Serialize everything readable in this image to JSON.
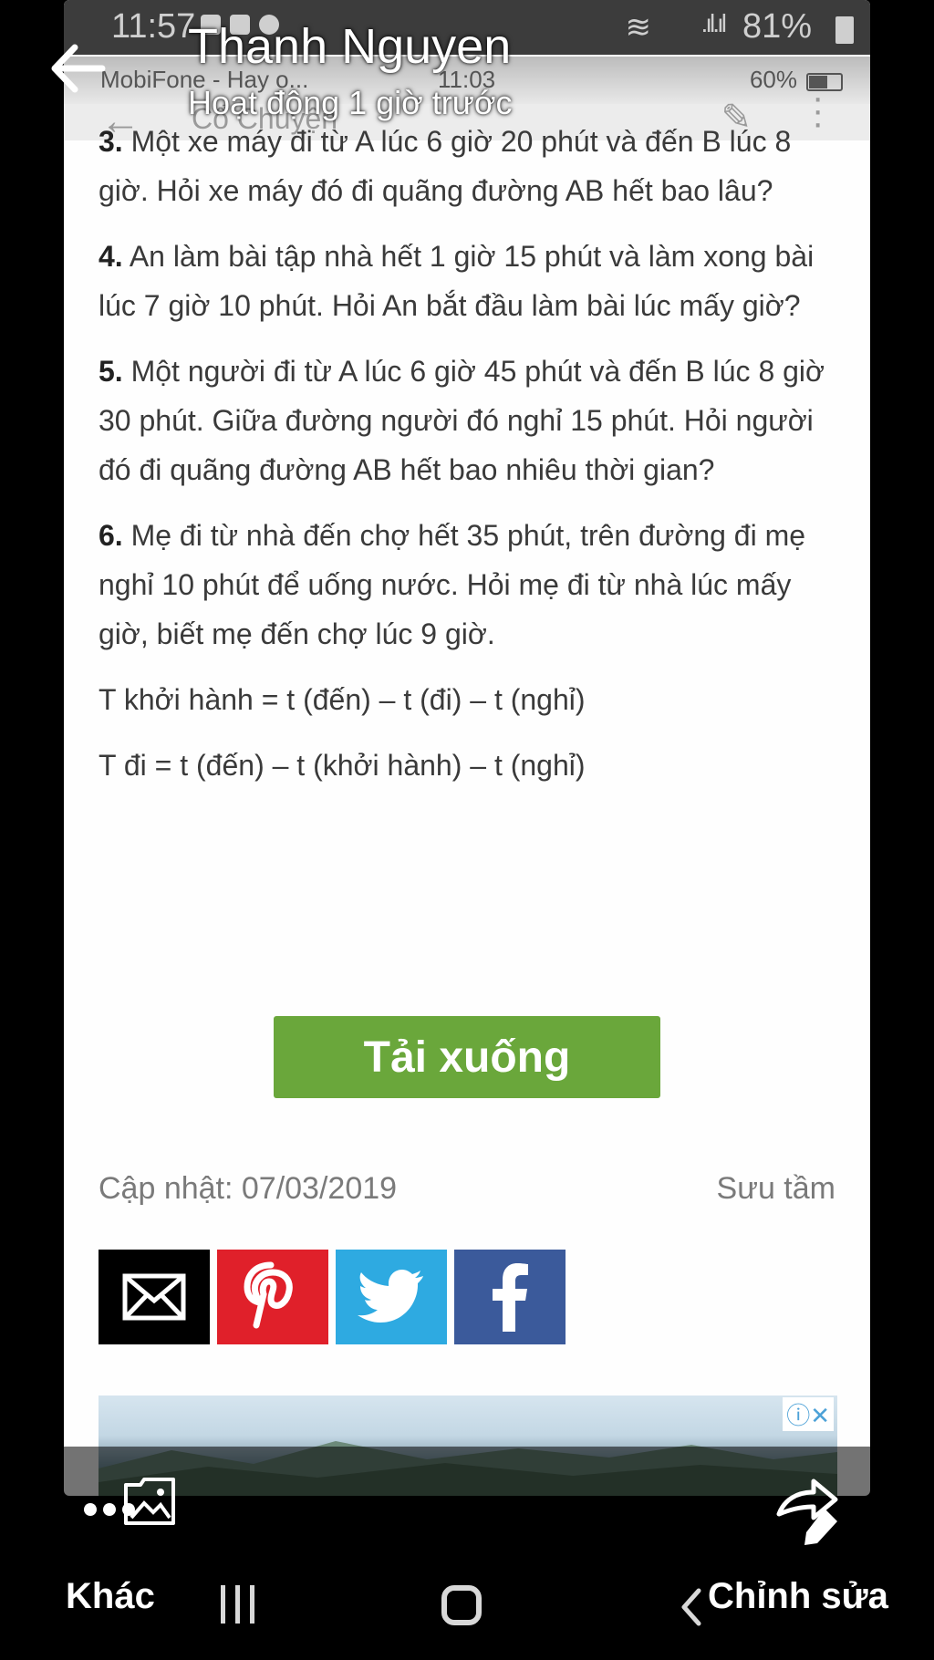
{
  "viewer": {
    "poster_name": "Thanh Nguyen",
    "posted_time": "Hoạt động 1 giờ trước"
  },
  "inner_status": {
    "clock": "11:57",
    "battery": "81%",
    "carrier": "MobiFone - Hay o...",
    "time": "11:03",
    "battery2": "60%"
  },
  "app_bar": {
    "title": "Cổ Chuyện"
  },
  "article": {
    "questions": [
      {
        "num": "3.",
        "text": " Một xe máy đi từ A lúc 6 giờ 20 phút và đến B lúc 8 giờ. Hỏi xe máy đó đi quãng đường AB hết bao lâu?"
      },
      {
        "num": "4.",
        "text": " An làm bài tập nhà hết 1 giờ 15 phút và làm xong bài lúc 7 giờ 10 phút. Hỏi An bắt đầu làm bài lúc mấy giờ?"
      },
      {
        "num": "5.",
        "text": " Một người đi từ A lúc 6 giờ 45 phút và đến B lúc 8 giờ 30 phút. Giữa đường người đó nghỉ 15 phút. Hỏi người đó đi quãng đường AB hết bao nhiêu thời gian?"
      },
      {
        "num": "6.",
        "text": " Mẹ đi từ nhà đến chợ hết 35 phút, trên đường đi mẹ nghỉ 10 phút để uống nước. Hỏi mẹ đi từ nhà lúc mấy giờ, biết mẹ đến chợ lúc 9 giờ."
      }
    ],
    "formula1": "T khởi hành = t (đến) – t (đi) – t (nghỉ)",
    "formula2": "T đi = t (đến) – t (khởi hành) – t (nghỉ)",
    "download_label": "Tải xuống",
    "updated": "Cập nhật: 07/03/2019",
    "source": "Sưu tầm"
  },
  "share_icons": [
    "email-icon",
    "pinterest-icon",
    "twitter-icon",
    "facebook-icon"
  ],
  "nav": {
    "more_label": "Khác",
    "edit_label": "Chỉnh sửa"
  }
}
